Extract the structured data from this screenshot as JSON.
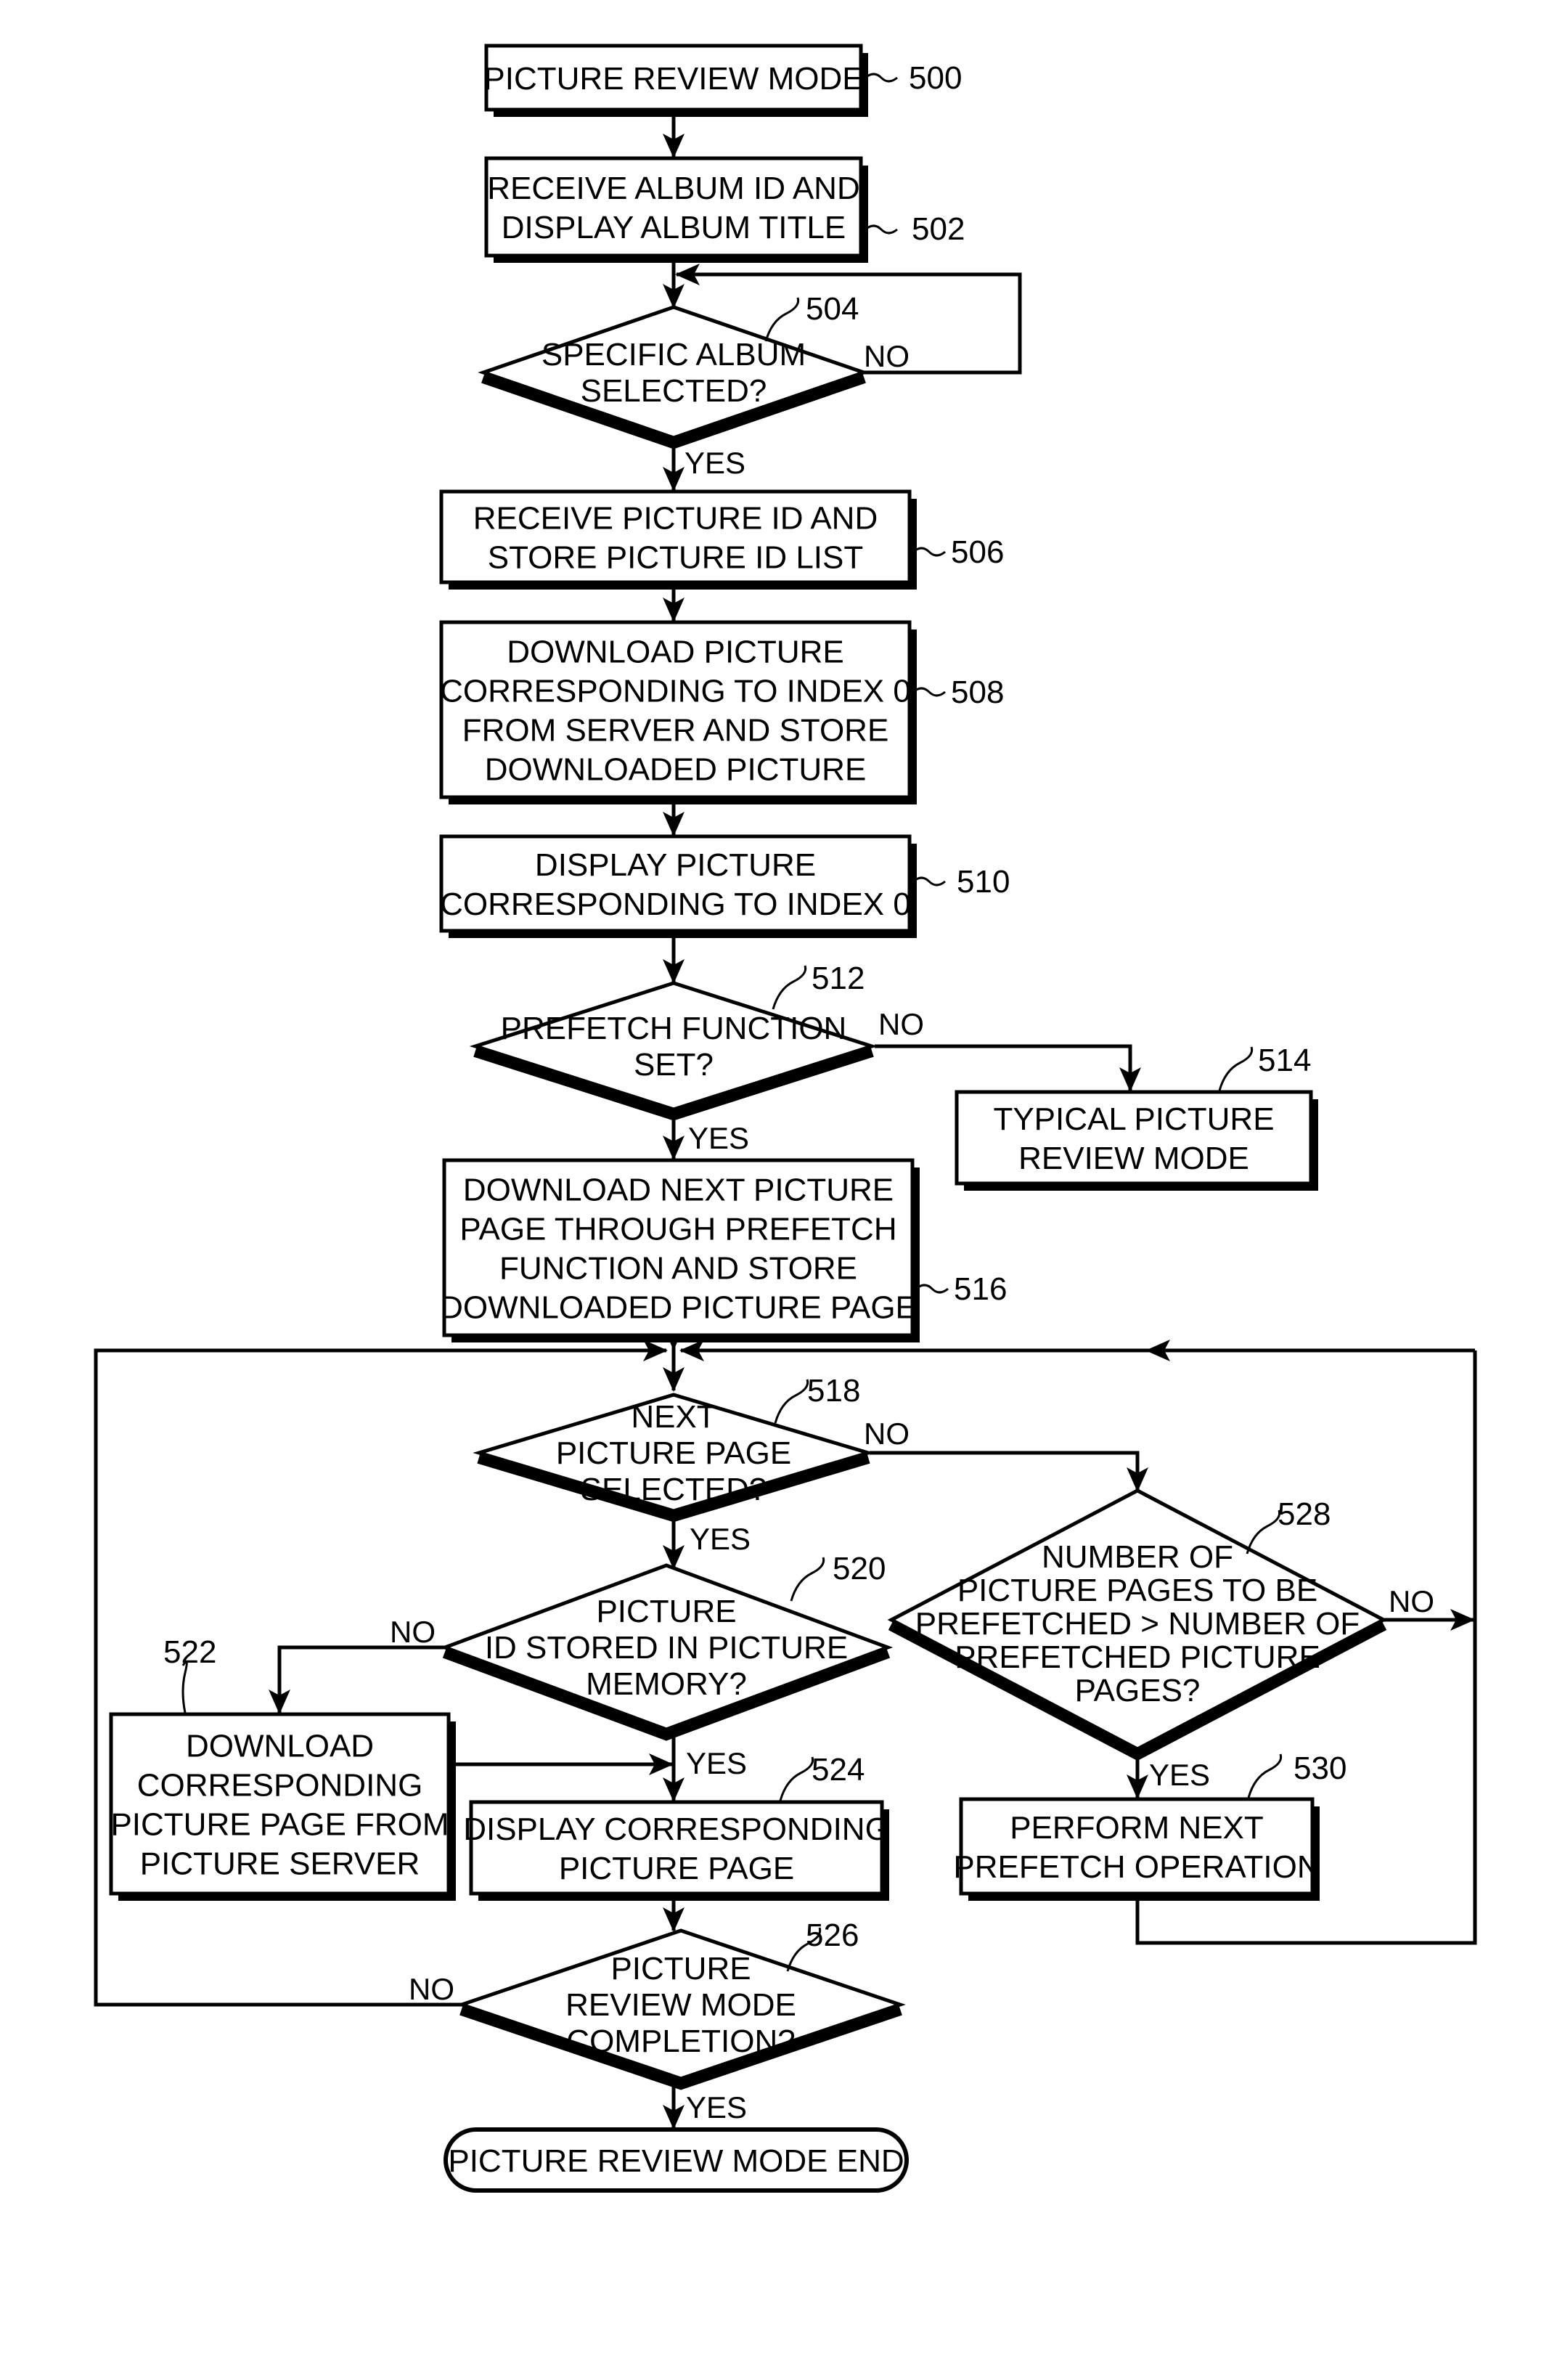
{
  "figure": {
    "type": "flowchart",
    "colors": {
      "ink": "#000000",
      "background": "#ffffff"
    }
  },
  "nodes": {
    "n500": {
      "ref": "500",
      "shape": "box",
      "lines": [
        "PICTURE REVIEW MODE"
      ]
    },
    "n502": {
      "ref": "502",
      "shape": "box",
      "lines": [
        "RECEIVE ALBUM ID AND",
        "DISPLAY ALBUM TITLE"
      ]
    },
    "n504": {
      "ref": "504",
      "shape": "decision",
      "lines": [
        "SPECIFIC ALBUM",
        "SELECTED?"
      ]
    },
    "n506": {
      "ref": "506",
      "shape": "box",
      "lines": [
        "RECEIVE PICTURE ID AND",
        "STORE PICTURE ID LIST"
      ]
    },
    "n508": {
      "ref": "508",
      "shape": "box",
      "lines": [
        "DOWNLOAD PICTURE",
        "CORRESPONDING TO INDEX 0",
        "FROM SERVER AND STORE",
        "DOWNLOADED PICTURE"
      ]
    },
    "n510": {
      "ref": "510",
      "shape": "box",
      "lines": [
        "DISPLAY PICTURE",
        "CORRESPONDING TO INDEX 0"
      ]
    },
    "n512": {
      "ref": "512",
      "shape": "decision",
      "lines": [
        "PREFETCH FUNCTION",
        "SET?"
      ]
    },
    "n514": {
      "ref": "514",
      "shape": "box",
      "lines": [
        "TYPICAL PICTURE",
        "REVIEW MODE"
      ]
    },
    "n516": {
      "ref": "516",
      "shape": "box",
      "lines": [
        "DOWNLOAD NEXT PICTURE",
        "PAGE THROUGH PREFETCH",
        "FUNCTION AND STORE",
        "DOWNLOADED PICTURE PAGE"
      ]
    },
    "n518": {
      "ref": "518",
      "shape": "decision",
      "lines": [
        "NEXT",
        "PICTURE PAGE",
        "SELECTED?"
      ]
    },
    "n520": {
      "ref": "520",
      "shape": "decision",
      "lines": [
        "PICTURE",
        "ID STORED IN PICTURE",
        "MEMORY?"
      ]
    },
    "n522": {
      "ref": "522",
      "shape": "box",
      "lines": [
        "DOWNLOAD",
        "CORRESPONDING",
        "PICTURE PAGE FROM",
        "PICTURE SERVER"
      ]
    },
    "n524": {
      "ref": "524",
      "shape": "box",
      "lines": [
        "DISPLAY CORRESPONDING",
        "PICTURE PAGE"
      ]
    },
    "n526": {
      "ref": "526",
      "shape": "decision",
      "lines": [
        "PICTURE",
        "REVIEW MODE",
        "COMPLETION?"
      ]
    },
    "n528": {
      "ref": "528",
      "shape": "decision",
      "lines": [
        "NUMBER OF",
        "PICTURE PAGES TO BE",
        "PREFETCHED > NUMBER OF",
        "PREFETCHED PICTURE",
        "PAGES?"
      ]
    },
    "n530": {
      "ref": "530",
      "shape": "box",
      "lines": [
        "PERFORM NEXT",
        "PREFETCH OPERATION"
      ]
    },
    "end": {
      "shape": "terminal",
      "lines": [
        "PICTURE REVIEW MODE END"
      ]
    }
  },
  "edges": [
    {
      "from": "n500",
      "to": "n502",
      "label": ""
    },
    {
      "from": "n502",
      "to": "n504",
      "label": ""
    },
    {
      "from": "n504",
      "to": "n504",
      "label": "NO"
    },
    {
      "from": "n504",
      "to": "n506",
      "label": "YES"
    },
    {
      "from": "n506",
      "to": "n508",
      "label": ""
    },
    {
      "from": "n508",
      "to": "n510",
      "label": ""
    },
    {
      "from": "n510",
      "to": "n512",
      "label": ""
    },
    {
      "from": "n512",
      "to": "n514",
      "label": "NO"
    },
    {
      "from": "n512",
      "to": "n516",
      "label": "YES"
    },
    {
      "from": "n516",
      "to": "n518",
      "label": ""
    },
    {
      "from": "n518",
      "to": "n528",
      "label": "NO"
    },
    {
      "from": "n518",
      "to": "n520",
      "label": "YES"
    },
    {
      "from": "n520",
      "to": "n522",
      "label": "NO"
    },
    {
      "from": "n520",
      "to": "n524",
      "label": "YES"
    },
    {
      "from": "n522",
      "to": "n524",
      "label": ""
    },
    {
      "from": "n524",
      "to": "n526",
      "label": ""
    },
    {
      "from": "n526",
      "to": "n518",
      "label": "NO"
    },
    {
      "from": "n526",
      "to": "end",
      "label": "YES"
    },
    {
      "from": "n528",
      "to": "n518",
      "label": "NO"
    },
    {
      "from": "n528",
      "to": "n530",
      "label": "YES"
    },
    {
      "from": "n530",
      "to": "n518",
      "label": ""
    }
  ],
  "branch_labels": {
    "yes": "YES",
    "no": "NO"
  }
}
